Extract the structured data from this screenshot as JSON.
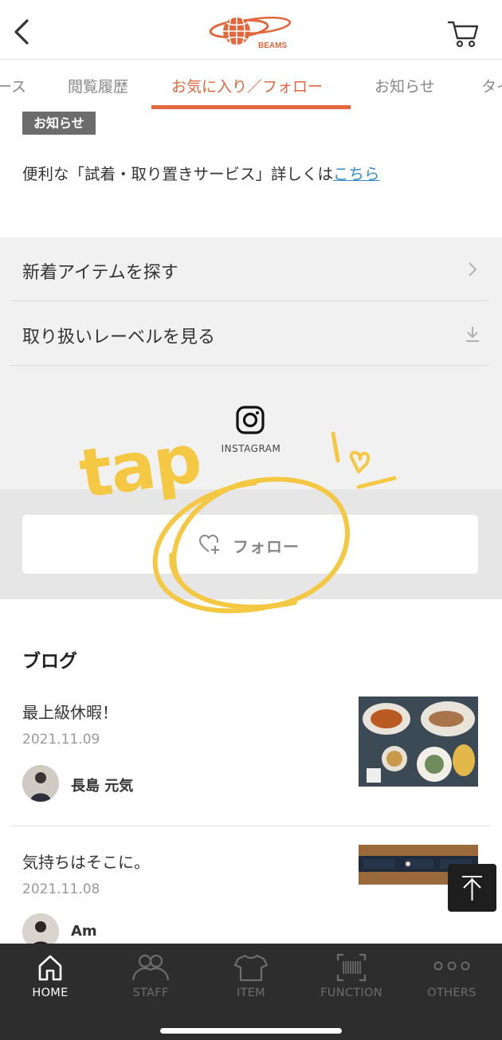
{
  "header": {
    "back_icon": "chevron-left-icon",
    "logo_text": "BEAMS",
    "cart_icon": "cart-icon"
  },
  "tabs": [
    {
      "label": "ース"
    },
    {
      "label": "閲覧履歴"
    },
    {
      "label": "お気に入り／フォロー",
      "active": true
    },
    {
      "label": "お知らせ"
    },
    {
      "label": "タイ"
    }
  ],
  "notice": {
    "badge": "お知らせ",
    "text_prefix": "便利な「試着・取り置きサービス」詳しくは",
    "link_text": "こちら"
  },
  "menu": {
    "items": [
      {
        "label": "新着アイテムを探す",
        "icon": "chevron-right-icon"
      },
      {
        "label": "取り扱いレーベルを見る",
        "icon": "download-icon"
      }
    ]
  },
  "instagram": {
    "icon": "instagram-icon",
    "label": "INSTAGRAM"
  },
  "follow": {
    "label": "フォロー",
    "icon": "heart-plus-icon"
  },
  "annotation": {
    "tap_text": "tap",
    "color": "#f4c842"
  },
  "blog": {
    "title": "ブログ",
    "posts": [
      {
        "title": "最上級休暇！",
        "date": "2021.11.09",
        "author": "長島 元気"
      },
      {
        "title": "気持ちはそこに。",
        "date": "2021.11.08",
        "author": "Am"
      }
    ]
  },
  "bottom_nav": {
    "items": [
      {
        "label": "HOME",
        "icon": "home-icon",
        "active": true
      },
      {
        "label": "STAFF",
        "icon": "staff-icon"
      },
      {
        "label": "ITEM",
        "icon": "tshirt-icon"
      },
      {
        "label": "FUNCTION",
        "icon": "barcode-icon"
      },
      {
        "label": "OTHERS",
        "icon": "more-dots-icon"
      }
    ]
  },
  "colors": {
    "accent": "#e2673d",
    "link": "#3a8fc8",
    "nav_bg": "#2d2d2d"
  }
}
